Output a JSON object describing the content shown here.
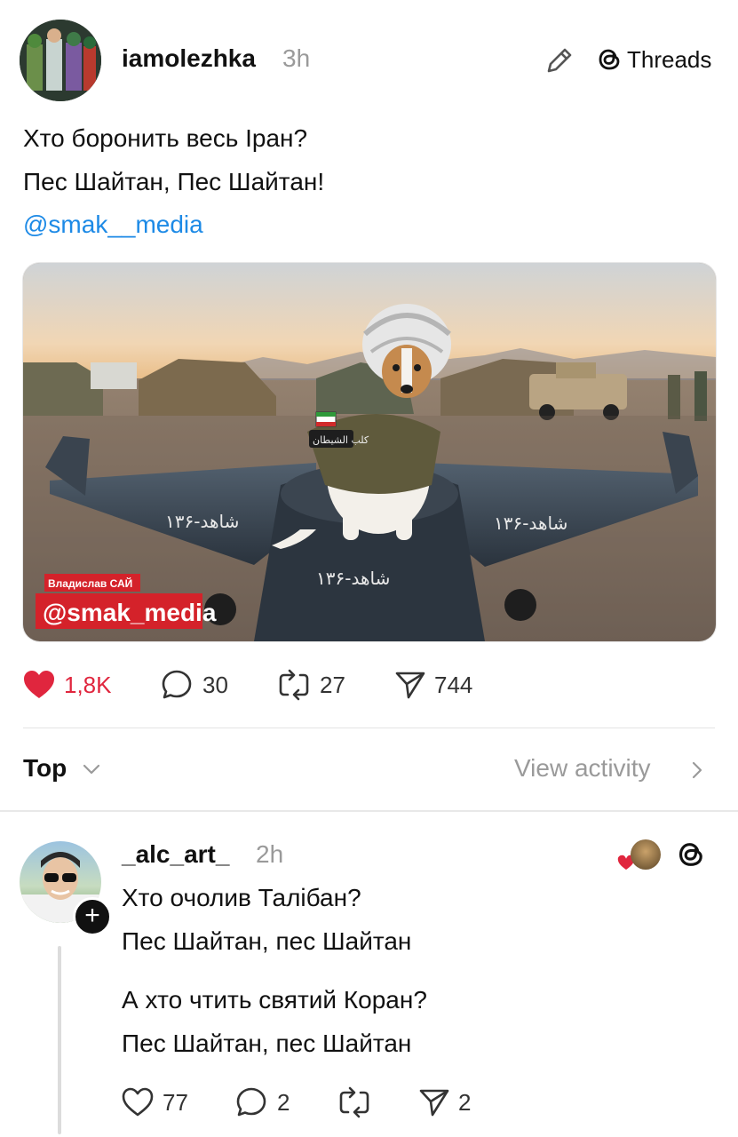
{
  "post": {
    "username": "iamolezhka",
    "time": "3h",
    "platform_label": "Threads",
    "text_lines": [
      "Хто боронить весь Іран?",
      "Пес Шайтан, Пес Шайтан!"
    ],
    "mention": "@smak__media",
    "image": {
      "caption_small": "Владислав САЙ",
      "caption_big": "@smak_media",
      "drone_marking": "شاهد-۱۳۶",
      "patch_text": "كلب الشيطان"
    },
    "stats": {
      "likes": "1,8K",
      "comments": "30",
      "reposts": "27",
      "shares": "744"
    }
  },
  "sort": {
    "label": "Top",
    "view_activity": "View activity"
  },
  "reply": {
    "username": "_alc_art_",
    "time": "2h",
    "text_lines": [
      "Хто очолив Талібан?",
      "Пес Шайтан, пес Шайтан",
      "А хто чтить святий Коран?",
      "Пес Шайтан, пес Шайтан"
    ],
    "stats": {
      "likes": "77",
      "comments": "2",
      "reposts": "",
      "shares": "2"
    }
  },
  "colors": {
    "like_red": "#e0263e",
    "mention_blue": "#1d8ae6",
    "muted": "#9a9a9a"
  }
}
